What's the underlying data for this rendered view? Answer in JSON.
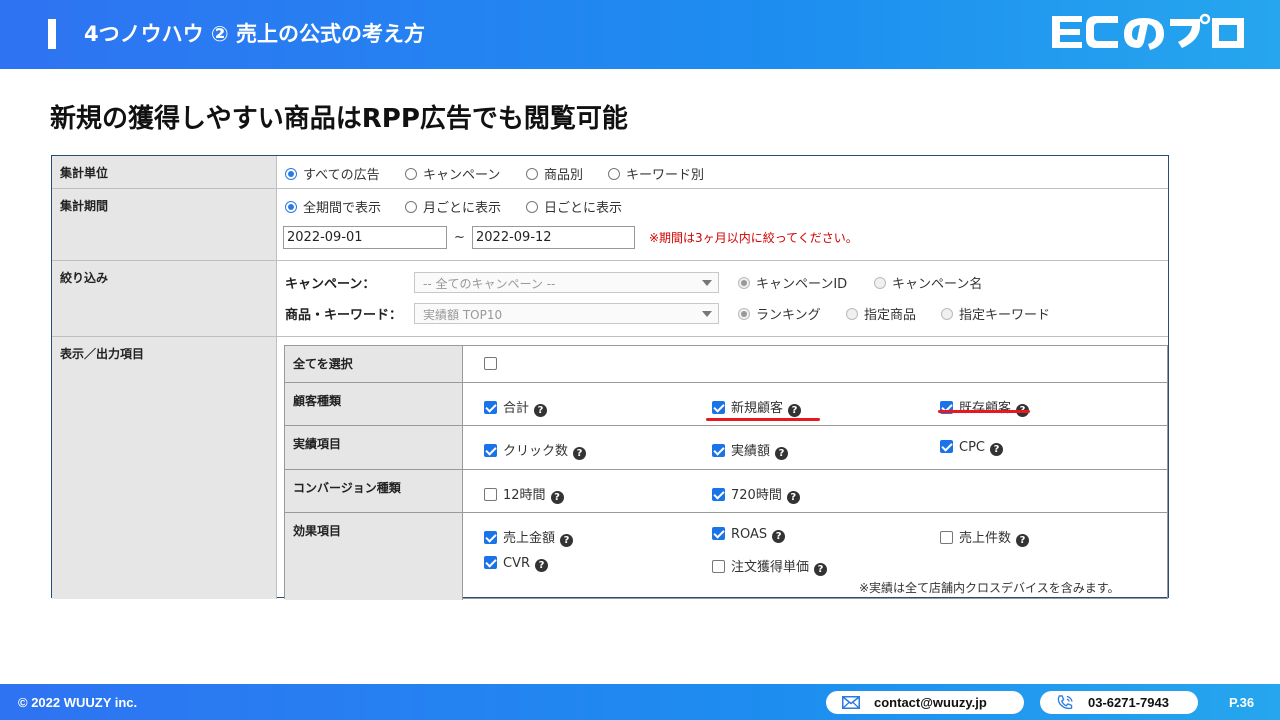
{
  "header": {
    "title": "4つノウハウ  ② 売上の公式の考え方",
    "logo": "ECのプロ"
  },
  "headline": "新規の獲得しやすい商品はRPP広告でも閲覧可能",
  "form": {
    "aggregation_unit": {
      "label": "集計単位",
      "options": [
        "すべての広告",
        "キャンペーン",
        "商品別",
        "キーワード別"
      ],
      "selected": "すべての広告"
    },
    "aggregation_period": {
      "label": "集計期間",
      "options": [
        "全期間で表示",
        "月ごとに表示",
        "日ごとに表示"
      ],
      "selected": "全期間で表示",
      "start_date": "2022-09-01",
      "tilde": "~",
      "end_date": "2022-09-12",
      "warning": "※期間は3ヶ月以内に絞ってください。"
    },
    "filter": {
      "label": "絞り込み",
      "campaign_label": "キャンペーン：",
      "campaign_select": "-- 全てのキャンペーン --",
      "campaign_options": [
        "キャンペーンID",
        "キャンペーン名"
      ],
      "product_label": "商品・キーワード：",
      "product_select": "実績額 TOP10",
      "product_options": [
        "ランキング",
        "指定商品",
        "指定キーワード"
      ]
    },
    "display": {
      "label": "表示／出力項目",
      "select_all_label": "全てを選択",
      "customer_type": {
        "label": "顧客種類",
        "items": [
          "合計",
          "新規顧客",
          "既存顧客"
        ]
      },
      "performance": {
        "label": "実績項目",
        "items": [
          "クリック数",
          "実績額",
          "CPC"
        ]
      },
      "conversion": {
        "label": "コンバージョン種類",
        "items": [
          "12時間",
          "720時間"
        ]
      },
      "effect": {
        "label": "効果項目",
        "items": [
          "売上金額",
          "ROAS",
          "売上件数",
          "CVR",
          "注文獲得単価"
        ]
      },
      "note": "※実績は全て店舗内クロスデバイスを含みます。",
      "help_glyph": "?"
    }
  },
  "footer": {
    "copyright": "© 2022 WUUZY inc.",
    "email": "contact@wuuzy.jp",
    "phone": "03-6271-7943",
    "page": "P.36"
  },
  "colors": {
    "header_start": "#2f73f2",
    "header_end": "#26a6ee",
    "checkbox": "#1a73e8",
    "warning": "#d40000",
    "underline": "#e8191c"
  }
}
